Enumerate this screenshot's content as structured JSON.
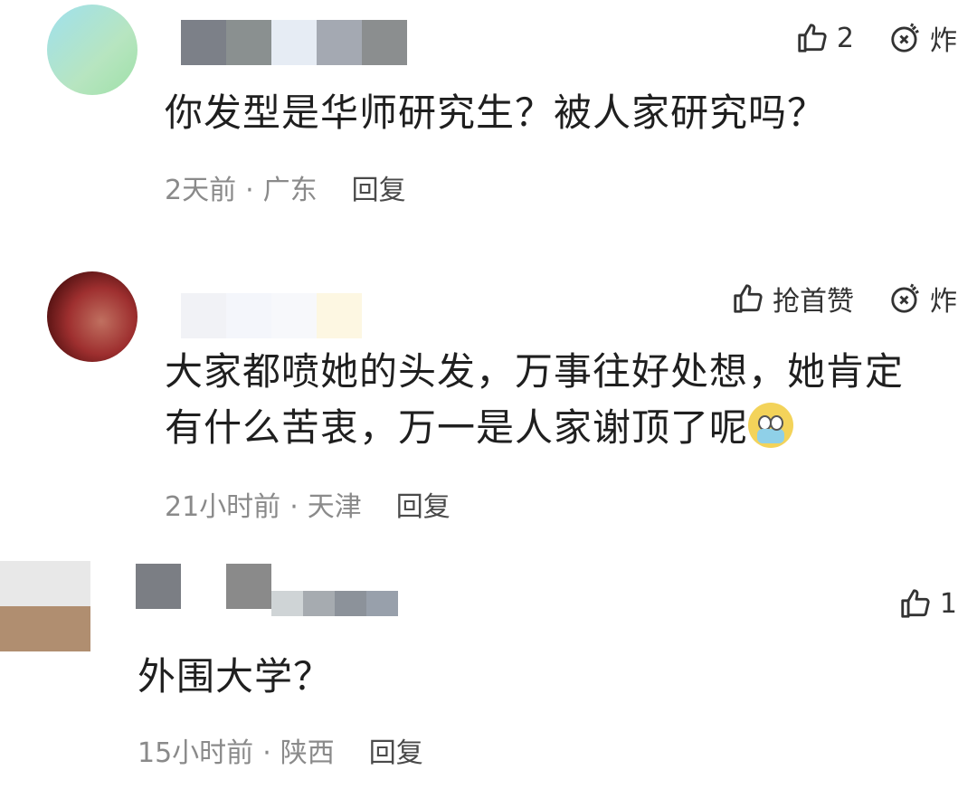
{
  "comments": [
    {
      "text": "你发型是华师研究生？被人家研究吗？",
      "time": "2天前",
      "location": "广东",
      "reply_label": "回复",
      "like_label": "2",
      "bomb_label": "炸"
    },
    {
      "text_line1": "大家都喷她的头发，万事往好处想，她肯定",
      "text_line2": "有什么苦衷，万一是人家谢顶了呢",
      "emoji_icon": "fearful-mask-emoji",
      "time": "21小时前",
      "location": "天津",
      "reply_label": "回复",
      "like_label": "抢首赞",
      "bomb_label": "炸"
    },
    {
      "text": "外围大学？",
      "time": "15小时前",
      "location": "陕西",
      "reply_label": "回复",
      "like_label": "1"
    }
  ],
  "separator": "·",
  "colors": {
    "text": "#1f1f1f",
    "meta": "#8a8a8a",
    "action": "#333333"
  }
}
